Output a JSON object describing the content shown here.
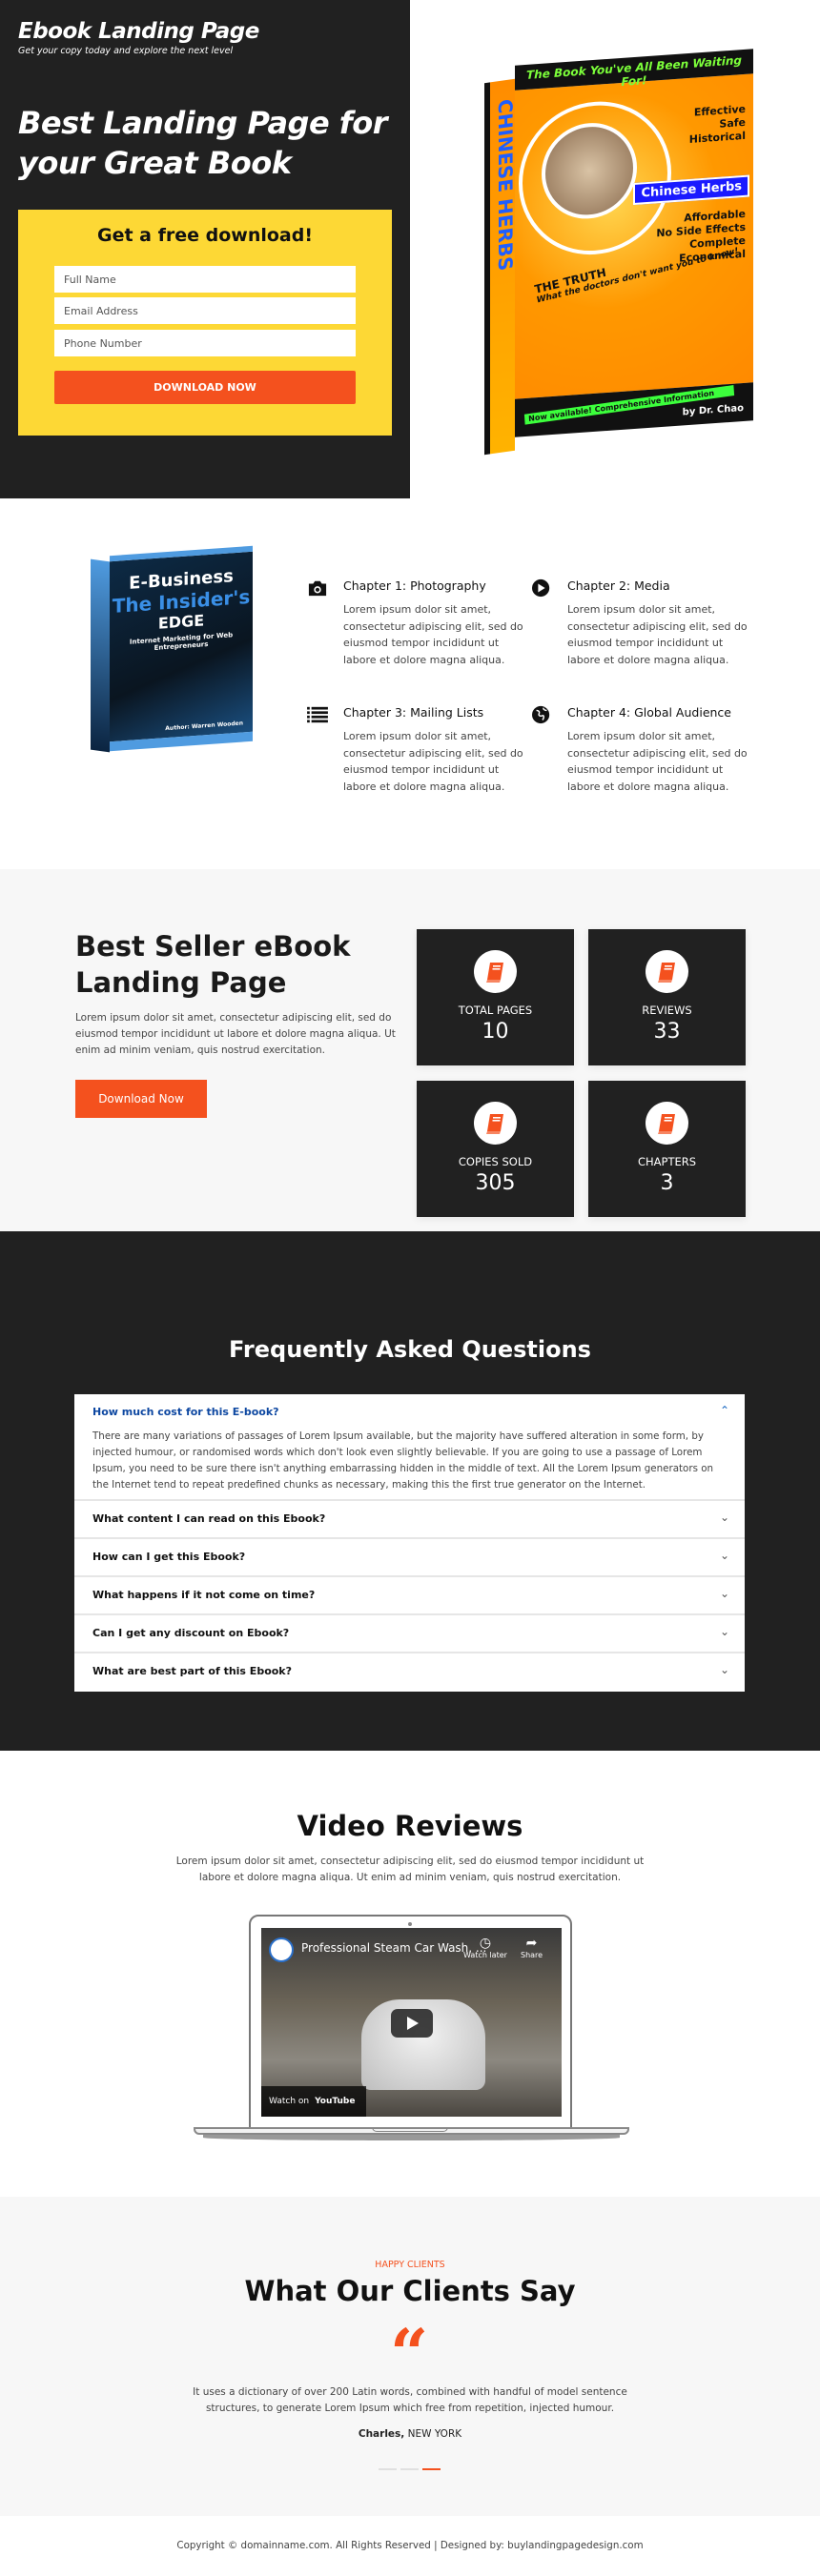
{
  "colors": {
    "accent": "#f4511e",
    "dark": "#212121",
    "form_bg": "#fdd835",
    "light_bg": "#f7f7f7",
    "faq_active": "#0d47a1"
  },
  "hero": {
    "brand": "Ebook Landing Page",
    "tagline": "Get your copy today and explore the next level",
    "headline": "Best Landing Page for your Great Book",
    "form": {
      "title": "Get a free download!",
      "fields": [
        {
          "placeholder": "Full Name"
        },
        {
          "placeholder": "Email Address"
        },
        {
          "placeholder": "Phone Number"
        }
      ],
      "button": "DOWNLOAD NOW"
    },
    "book_cover": {
      "top": "The Book You've All Been Waiting For!",
      "spine": "CHINESE HERBS",
      "list_top": [
        "Effective",
        "Safe",
        "Historical"
      ],
      "chip": "Chinese Herbs",
      "list_bottom": [
        "Affordable",
        "No Side Effects",
        "Complete",
        "Economical"
      ],
      "truth": "THE TRUTH",
      "truth_sub": "What the doctors don't want you to know!",
      "author": "by Dr. Chao",
      "banner": "Now available! Comprehensive Information"
    }
  },
  "features": {
    "book_cover": {
      "line1": "E-Business",
      "line2": "The Insider's",
      "line3": "EDGE",
      "subtitle": "Internet Marketing for Web Entrepreneurs",
      "author": "Author: Warren Wooden"
    },
    "items": [
      {
        "icon": "camera-icon",
        "title": "Chapter 1: Photography",
        "text": "Lorem ipsum dolor sit amet, consectetur adipiscing elit, sed do eiusmod tempor incididunt ut labore et dolore magna aliqua."
      },
      {
        "icon": "play-circle-icon",
        "title": "Chapter 2: Media",
        "text": "Lorem ipsum dolor sit amet, consectetur adipiscing elit, sed do eiusmod tempor incididunt ut labore et dolore magna aliqua."
      },
      {
        "icon": "list-icon",
        "title": "Chapter 3: Mailing Lists",
        "text": "Lorem ipsum dolor sit amet, consectetur adipiscing elit, sed do eiusmod tempor incididunt ut labore et dolore magna aliqua."
      },
      {
        "icon": "globe-icon",
        "title": "Chapter 4: Global Audience",
        "text": "Lorem ipsum dolor sit amet, consectetur adipiscing elit, sed do eiusmod tempor incididunt ut labore et dolore magna aliqua."
      }
    ]
  },
  "stats": {
    "title": "Best Seller eBook Landing Page",
    "text": "Lorem ipsum dolor sit amet, consectetur adipiscing elit, sed do eiusmod tempor incididunt ut labore et dolore magna aliqua. Ut enim ad minim veniam, quis nostrud exercitation.",
    "button": "Download Now",
    "cards": [
      {
        "icon": "book-icon",
        "label": "TOTAL PAGES",
        "value": "10"
      },
      {
        "icon": "book-icon",
        "label": "REVIEWS",
        "value": "33"
      },
      {
        "icon": "book-icon",
        "label": "COPIES SOLD",
        "value": "305"
      },
      {
        "icon": "book-icon",
        "label": "CHAPTERS",
        "value": "3"
      }
    ]
  },
  "faq": {
    "title": "Frequently Asked Questions",
    "items": [
      {
        "q": "How much cost for this E-book?",
        "a": "There are many variations of passages of Lorem Ipsum available, but the majority have suffered alteration in some form, by injected humour, or randomised words which don't look even slightly believable. If you are going to use a passage of Lorem Ipsum, you need to be sure there isn't anything embarrassing hidden in the middle of text. All the Lorem Ipsum generators on the Internet tend to repeat predefined chunks as necessary, making this the first true generator on the Internet.",
        "open": true
      },
      {
        "q": "What content I can read on this Ebook?"
      },
      {
        "q": "How can I get this Ebook?"
      },
      {
        "q": "What happens if it not come on time?"
      },
      {
        "q": "Can I get any discount on Ebook?"
      },
      {
        "q": "What are best part of this Ebook?"
      }
    ]
  },
  "video": {
    "title": "Video Reviews",
    "text": "Lorem ipsum dolor sit amet, consectetur adipiscing elit, sed do eiusmod tempor incididunt ut labore et dolore magna aliqua. Ut enim ad minim veniam, quis nostrud exercitation.",
    "video_title": "Professional Steam Car Wash, ...",
    "watch_later": "Watch later",
    "share": "Share",
    "watch_on": "Watch on",
    "youtube": "YouTube"
  },
  "testimonials": {
    "eyebrow": "HAPPY CLIENTS",
    "title": "What Our Clients Say",
    "quote": "It uses a dictionary of over 200 Latin words, combined with handful of model sentence structures, to generate Lorem Ipsum which free from repetition, injected humour.",
    "author": "Charles,",
    "location": "NEW YORK",
    "slide_count": 3,
    "active_slide": 3
  },
  "footer": {
    "text": "Copyright © domainname.com. All Rights Reserved | Designed by: buylandingpagedesign.com"
  }
}
